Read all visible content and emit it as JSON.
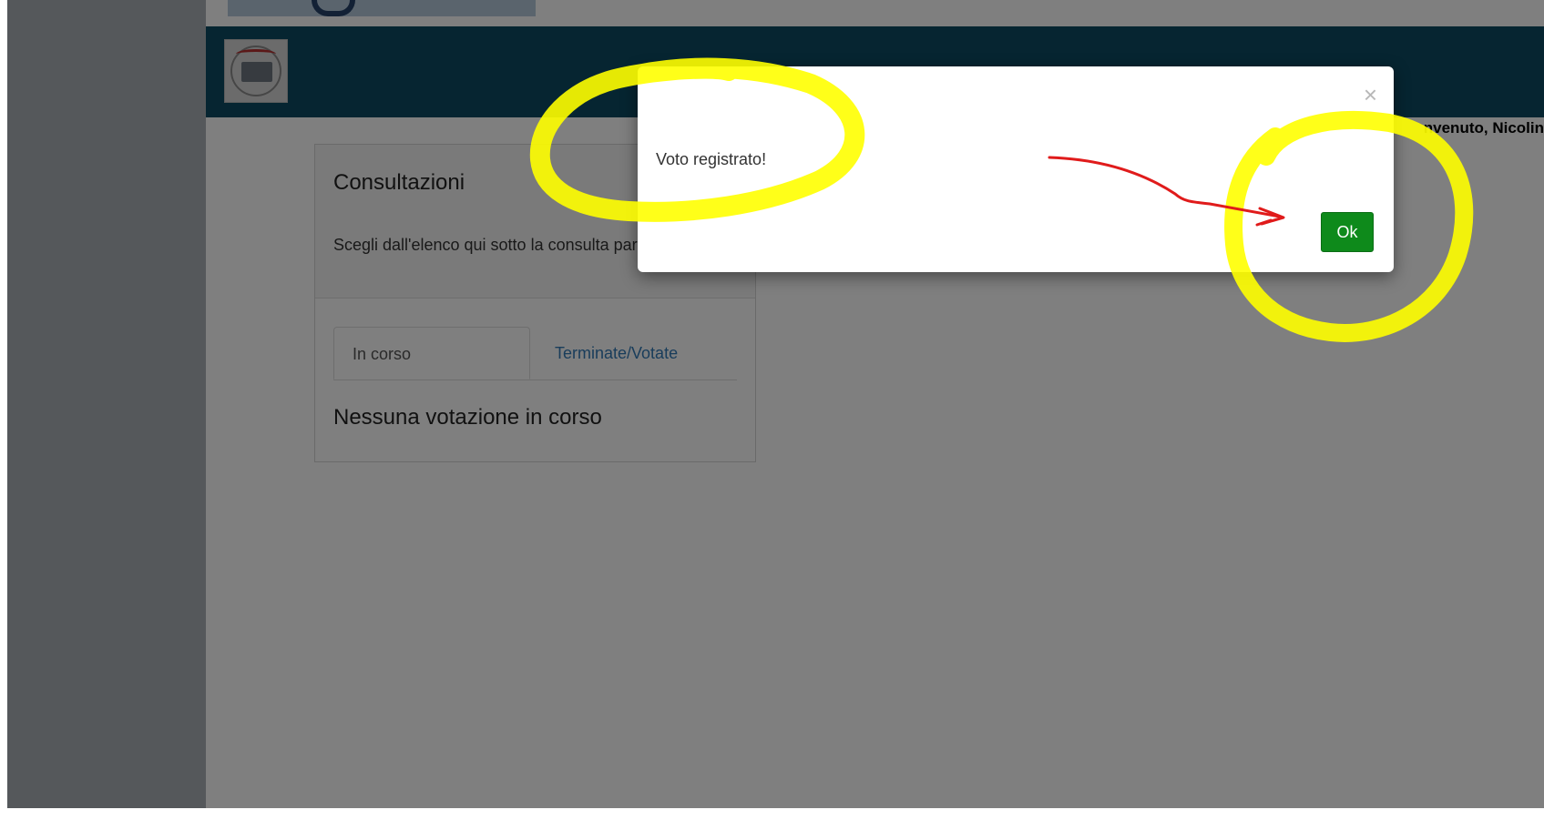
{
  "header": {
    "welcome_text": "nvenuto,  Nicolin"
  },
  "panel": {
    "title": "Consultazioni",
    "description": "Scegli dall'elenco qui sotto la consulta partecipare",
    "tabs": [
      {
        "label": "In corso",
        "active": true
      },
      {
        "label": "Terminate/Votate",
        "active": false
      }
    ],
    "empty_message": "Nessuna votazione in corso"
  },
  "modal": {
    "message": "Voto registrato!",
    "close_symbol": "×",
    "ok_label": "Ok"
  },
  "colors": {
    "header": "#0d4a63",
    "ok_button": "#0e8a1b",
    "highlight": "#ffff00",
    "arrow": "#e01b1b",
    "link": "#337ab7"
  }
}
